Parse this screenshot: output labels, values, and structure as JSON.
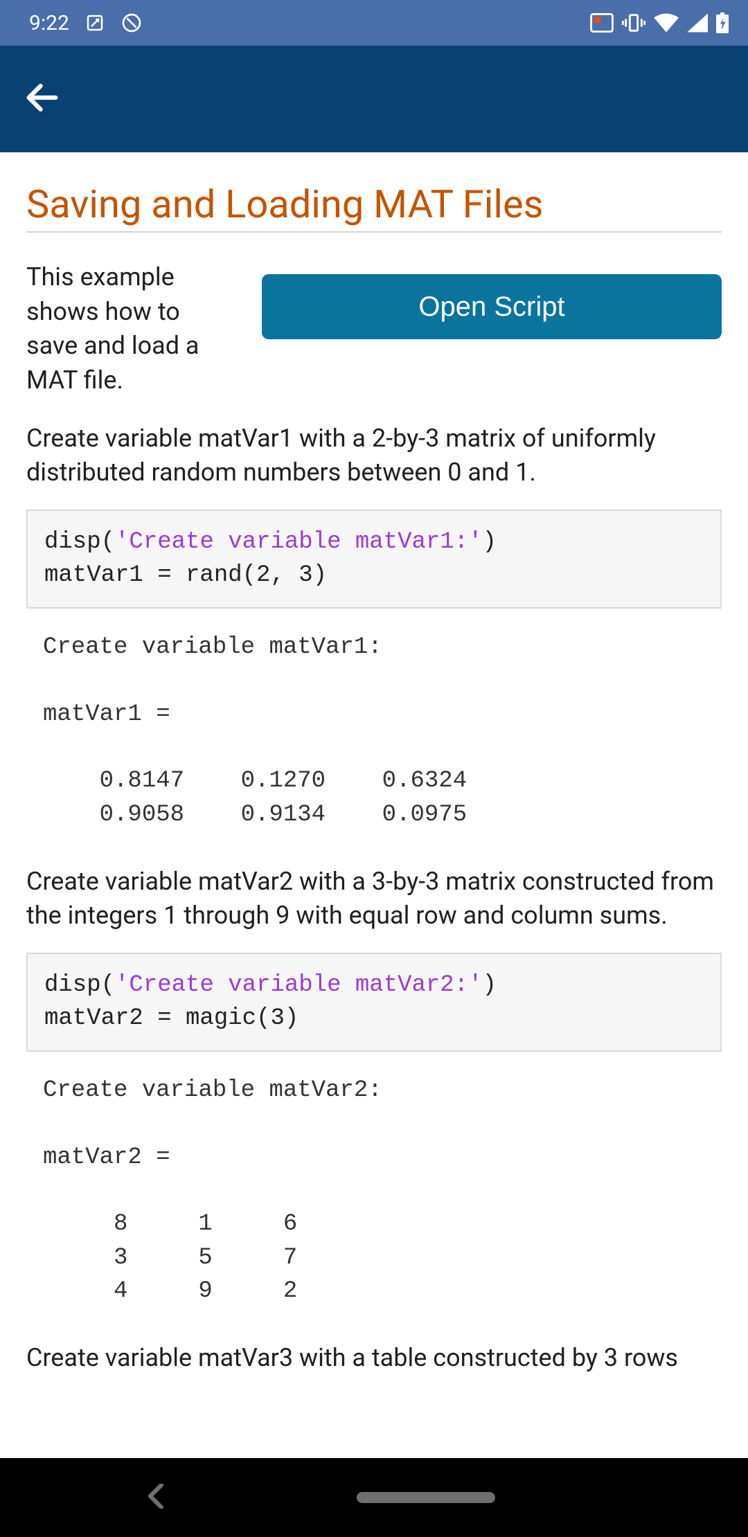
{
  "status": {
    "time": "9:22"
  },
  "page": {
    "title": "Saving and Loading MAT Files",
    "intro": "This example shows how to save and load a MAT file.",
    "open_button": "Open Script",
    "para1": "Create variable matVar1 with a 2-by-3 matrix of uniformly distributed random numbers between 0 and 1.",
    "code1_plain1": "disp(",
    "code1_str": "'Create variable matVar1:'",
    "code1_plain2": ")\nmatVar1 = rand(2, 3)",
    "output1": "Create variable matVar1:\n\nmatVar1 =\n\n    0.8147    0.1270    0.6324\n    0.9058    0.9134    0.0975\n",
    "para2": "Create variable matVar2 with a 3-by-3 matrix constructed from the integers 1 through 9 with equal row and column sums.",
    "code2_plain1": "disp(",
    "code2_str": "'Create variable matVar2:'",
    "code2_plain2": ")\nmatVar2 = magic(3)",
    "output2": "Create variable matVar2:\n\nmatVar2 =\n\n     8     1     6\n     3     5     7\n     4     9     2\n",
    "para3": "Create variable matVar3 with a table constructed by 3 rows"
  }
}
